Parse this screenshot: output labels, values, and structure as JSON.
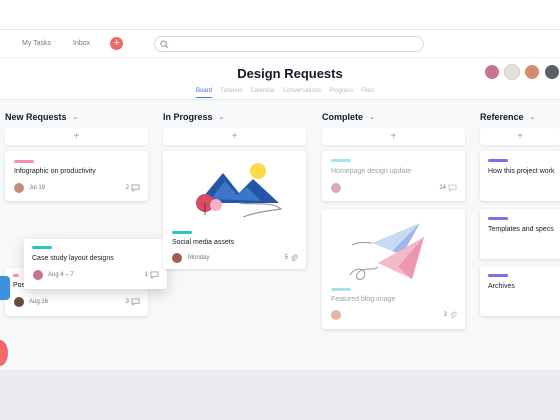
{
  "nav": {
    "my_tasks": "My Tasks",
    "inbox": "Inbox"
  },
  "header": {
    "title": "Design Requests",
    "tabs": [
      "Board",
      "Timeline",
      "Calendar",
      "Conversations",
      "Progress",
      "Files"
    ],
    "active_tab": "Board"
  },
  "columns": [
    {
      "title": "New Requests"
    },
    {
      "title": "In Progress"
    },
    {
      "title": "Complete"
    },
    {
      "title": "Reference"
    }
  ],
  "add_symbol": "+",
  "cards": {
    "infographic": {
      "title": "Infographic on productivity",
      "date": "Jul 19",
      "count": "2"
    },
    "case_study": {
      "title": "Case study layout designs",
      "date": "Aug 4 – 7",
      "count": "1"
    },
    "partial": {
      "title": "Pos",
      "date": "Aug 16",
      "count": "3"
    },
    "social": {
      "title": "Social media assets",
      "date": "Monday",
      "count": "5"
    },
    "homepage": {
      "title": "Homepage design update",
      "count": "14"
    },
    "blog": {
      "title": "Featured blog image",
      "count": "3"
    },
    "how": {
      "title": "How this project work"
    },
    "templates": {
      "title": "Templates and specs"
    },
    "archives": {
      "title": "Archives"
    }
  },
  "colors": {
    "pink": "#f58fb0",
    "teal": "#26c6c9",
    "purple": "#7a6ff0",
    "accent": "#4573d2",
    "plus": "#f06a6a"
  }
}
